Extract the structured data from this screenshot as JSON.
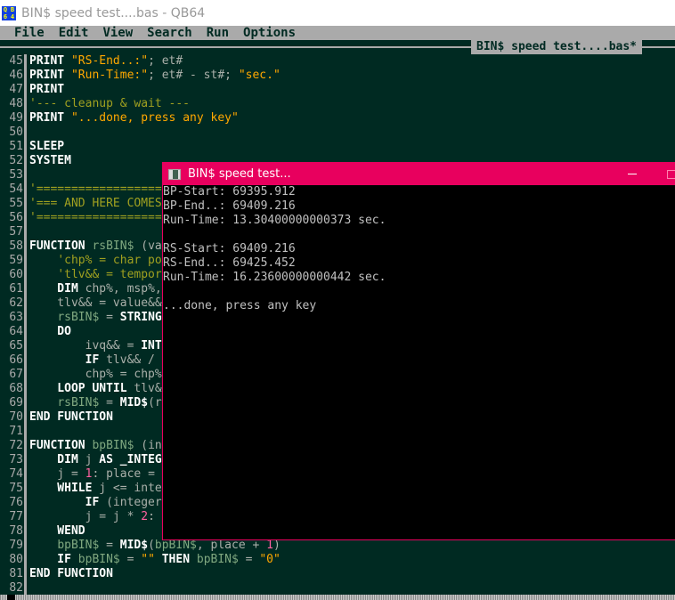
{
  "window": {
    "title": "BIN$ speed test....bas - QB64",
    "icon_text": [
      "Q",
      "B",
      "6",
      "4"
    ]
  },
  "menu": [
    "File",
    "Edit",
    "View",
    "Search",
    "Run",
    "Options"
  ],
  "editor": {
    "file_tab": "BIN$ speed test....bas*",
    "lines": [
      {
        "n": "45",
        "tokens": [
          [
            "PRINT ",
            "kw"
          ],
          [
            "\"RS-End..:\"",
            "str"
          ],
          [
            "; et#",
            "id"
          ]
        ]
      },
      {
        "n": "46",
        "tokens": [
          [
            "PRINT ",
            "kw"
          ],
          [
            "\"Run-Time:\"",
            "str"
          ],
          [
            "; et# - st#; ",
            "id"
          ],
          [
            "\"sec.\"",
            "str"
          ]
        ]
      },
      {
        "n": "47",
        "tokens": [
          [
            "PRINT",
            "kw"
          ]
        ]
      },
      {
        "n": "48",
        "tokens": [
          [
            "'--- cleanup & wait ---",
            "cmt"
          ]
        ]
      },
      {
        "n": "49",
        "tokens": [
          [
            "PRINT ",
            "kw"
          ],
          [
            "\"...done, press any key\"",
            "str"
          ]
        ]
      },
      {
        "n": "50",
        "tokens": []
      },
      {
        "n": "51",
        "tokens": [
          [
            "SLEEP",
            "kw"
          ]
        ]
      },
      {
        "n": "52",
        "tokens": [
          [
            "SYSTEM",
            "kw"
          ]
        ]
      },
      {
        "n": "53",
        "tokens": []
      },
      {
        "n": "54",
        "tokens": [
          [
            "'===================",
            "cmt"
          ]
        ]
      },
      {
        "n": "55",
        "tokens": [
          [
            "'=== AND HERE COMES",
            "cmt"
          ]
        ]
      },
      {
        "n": "56",
        "tokens": [
          [
            "'===================",
            "cmt"
          ]
        ]
      },
      {
        "n": "57",
        "tokens": []
      },
      {
        "n": "58",
        "tokens": [
          [
            "FUNCTION ",
            "kw"
          ],
          [
            "rsBIN$",
            "var"
          ],
          [
            " (va",
            "id"
          ]
        ]
      },
      {
        "n": "59",
        "tokens": [
          [
            "    ",
            "id"
          ],
          [
            "'chp% = char po",
            "cmt"
          ]
        ]
      },
      {
        "n": "60",
        "tokens": [
          [
            "    ",
            "id"
          ],
          [
            "'tlv&& = tempor",
            "cmt"
          ]
        ]
      },
      {
        "n": "61",
        "tokens": [
          [
            "    DIM ",
            "kw"
          ],
          [
            "chp%, msp%,",
            "id"
          ]
        ]
      },
      {
        "n": "62",
        "tokens": [
          [
            "    tlv&& = value&&",
            "id"
          ]
        ]
      },
      {
        "n": "63",
        "tokens": [
          [
            "    ",
            "id"
          ],
          [
            "rsBIN$",
            "var"
          ],
          [
            " = ",
            "id"
          ],
          [
            "STRING",
            "kw"
          ]
        ]
      },
      {
        "n": "64",
        "tokens": [
          [
            "    DO",
            "kw"
          ]
        ]
      },
      {
        "n": "65",
        "tokens": [
          [
            "        ivq&& = ",
            "id"
          ],
          [
            "INT",
            "kw"
          ]
        ]
      },
      {
        "n": "66",
        "tokens": [
          [
            "        IF ",
            "kw"
          ],
          [
            "tlv&& /",
            "id"
          ]
        ]
      },
      {
        "n": "67",
        "tokens": [
          [
            "        chp% = chp%",
            "id"
          ]
        ]
      },
      {
        "n": "68",
        "tokens": [
          [
            "    LOOP UNTIL ",
            "kw"
          ],
          [
            "tlv&",
            "id"
          ]
        ]
      },
      {
        "n": "69",
        "tokens": [
          [
            "    ",
            "id"
          ],
          [
            "rsBIN$",
            "var"
          ],
          [
            " = ",
            "id"
          ],
          [
            "MID$",
            "kw"
          ],
          [
            "(r",
            "id"
          ]
        ]
      },
      {
        "n": "70",
        "tokens": [
          [
            "END FUNCTION",
            "kw"
          ]
        ]
      },
      {
        "n": "71",
        "tokens": []
      },
      {
        "n": "72",
        "tokens": [
          [
            "FUNCTION ",
            "kw"
          ],
          [
            "bpBIN$",
            "var"
          ],
          [
            " (in",
            "id"
          ]
        ]
      },
      {
        "n": "73",
        "tokens": [
          [
            "    DIM ",
            "kw"
          ],
          [
            "j ",
            "id"
          ],
          [
            "AS _INTEG",
            "kw"
          ]
        ]
      },
      {
        "n": "74",
        "tokens": [
          [
            "    j = ",
            "id"
          ],
          [
            "1",
            "n"
          ],
          [
            ": place =",
            "id"
          ]
        ]
      },
      {
        "n": "75",
        "tokens": [
          [
            "    WHILE ",
            "kw"
          ],
          [
            "j <= inte",
            "id"
          ]
        ]
      },
      {
        "n": "76",
        "tokens": [
          [
            "        IF ",
            "kw"
          ],
          [
            "(integer",
            "id"
          ]
        ]
      },
      {
        "n": "77",
        "tokens": [
          [
            "        j = j * ",
            "id"
          ],
          [
            "2",
            "n"
          ],
          [
            ":",
            "id"
          ]
        ]
      },
      {
        "n": "78",
        "tokens": [
          [
            "    WEND",
            "kw"
          ]
        ]
      },
      {
        "n": "79",
        "tokens": [
          [
            "    ",
            "id"
          ],
          [
            "bpBIN$",
            "var"
          ],
          [
            " = ",
            "id"
          ],
          [
            "MID$",
            "kw"
          ],
          [
            "(",
            "id"
          ],
          [
            "bpBIN$",
            "var"
          ],
          [
            ", place + ",
            "id"
          ],
          [
            "1",
            "n"
          ],
          [
            ")",
            "id"
          ]
        ]
      },
      {
        "n": "80",
        "tokens": [
          [
            "    IF ",
            "kw"
          ],
          [
            "bpBIN$",
            "var"
          ],
          [
            " = ",
            "id"
          ],
          [
            "\"\"",
            "str"
          ],
          [
            " THEN ",
            "kw"
          ],
          [
            "bpBIN$",
            "var"
          ],
          [
            " = ",
            "id"
          ],
          [
            "\"0\"",
            "str"
          ]
        ]
      },
      {
        "n": "81",
        "tokens": [
          [
            "END FUNCTION",
            "kw"
          ]
        ]
      },
      {
        "n": "82",
        "tokens": []
      }
    ]
  },
  "console": {
    "title": "BIN$ speed test...",
    "lines": [
      "BP-Start: 69395.912",
      "BP-End..: 69409.216",
      "Run-Time: 13.30400000000373 sec.",
      "",
      "RS-Start: 69409.216",
      "RS-End..: 69425.452",
      "Run-Time: 16.23600000000442 sec.",
      "",
      "...done, press any key"
    ]
  },
  "colors": {
    "editor_bg": "#002a22",
    "console_title": "#e8005e",
    "string": "#ffa800",
    "comment": "#a0a020",
    "number": "#ff60a0"
  }
}
